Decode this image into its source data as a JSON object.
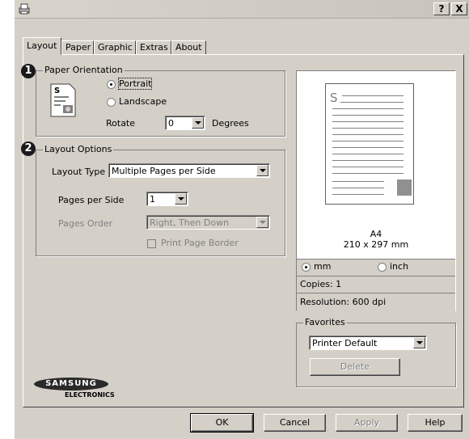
{
  "window": {
    "help_btn": "?",
    "close_btn": "X"
  },
  "tabs": [
    "Layout",
    "Paper",
    "Graphic",
    "Extras",
    "About"
  ],
  "orientation": {
    "badge": "1",
    "title": "Paper Orientation",
    "portrait": "Portrait",
    "landscape": "Landscape",
    "rotate_label": "Rotate",
    "rotate_value": "0",
    "degrees": "Degrees",
    "icon_letter": "S"
  },
  "layout": {
    "badge": "2",
    "title": "Layout Options",
    "type_label": "Layout Type",
    "type_value": "Multiple Pages per Side",
    "pps_label": "Pages per Side",
    "pps_value": "1",
    "order_label": "Pages Order",
    "order_value": "Right, Then Down",
    "border_label": "Print Page Border"
  },
  "preview": {
    "page_letter": "S",
    "paper_name": "A4",
    "paper_size": "210 x 297 mm",
    "unit_mm": "mm",
    "unit_inch": "inch",
    "copies": "Copies: 1",
    "resolution": "Resolution: 600 dpi"
  },
  "favorites": {
    "title": "Favorites",
    "value": "Printer Default",
    "delete": "Delete"
  },
  "logo": {
    "brand": "SAMSUNG",
    "sub": "ELECTRONICS"
  },
  "buttons": {
    "ok": "OK",
    "cancel": "Cancel",
    "apply": "Apply",
    "help": "Help"
  }
}
